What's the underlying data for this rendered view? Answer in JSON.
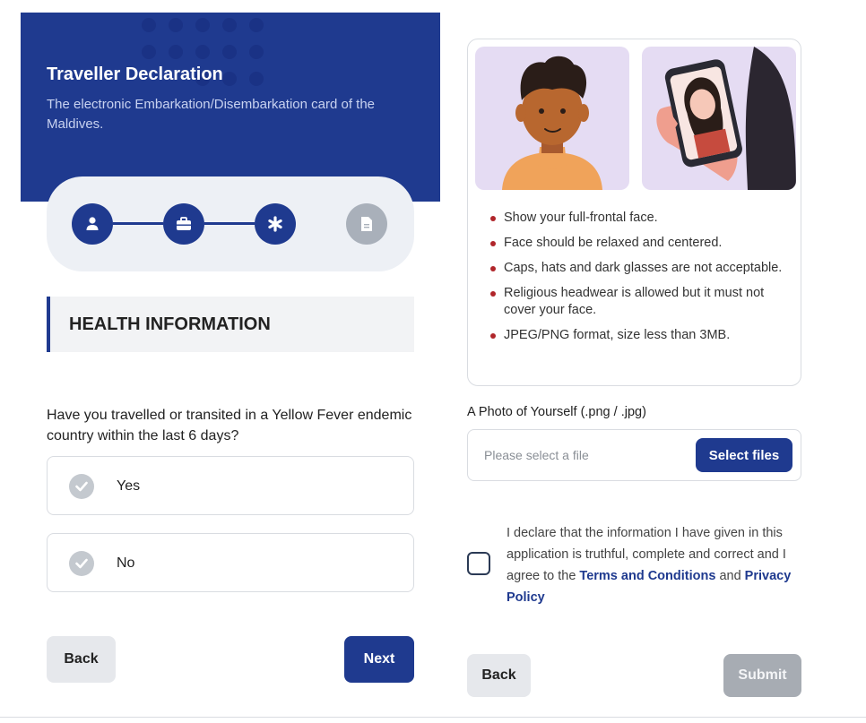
{
  "header": {
    "title": "Traveller Declaration",
    "subtitle": "The electronic Embarkation/Disembarkation card of the Maldives."
  },
  "stepper": {
    "steps": [
      {
        "icon": "user-icon",
        "state": "complete"
      },
      {
        "icon": "briefcase-icon",
        "state": "complete"
      },
      {
        "icon": "asterisk-icon",
        "state": "current"
      },
      {
        "icon": "document-icon",
        "state": "inactive"
      }
    ]
  },
  "section": {
    "title": "HEALTH INFORMATION"
  },
  "question": {
    "text": "Have you travelled or transited in a Yellow Fever endemic country within the last 6 days?",
    "options": [
      "Yes",
      "No"
    ]
  },
  "left_buttons": {
    "back": "Back",
    "next": "Next"
  },
  "photo_rules": [
    "Show your full-frontal face.",
    "Face should be relaxed and centered.",
    "Caps, hats and dark glasses are not acceptable.",
    "Religious headwear is allowed but it must not cover your face.",
    "JPEG/PNG format, size less than 3MB."
  ],
  "photo_upload": {
    "label": "A Photo of Yourself (.png / .jpg)",
    "placeholder": "Please select a file",
    "button": "Select files"
  },
  "declaration": {
    "text_start": "I declare that the information I have given in this application is truthful, complete and correct and I agree to the ",
    "terms_link": "Terms and Conditions",
    "and": " and ",
    "privacy_link": "Privacy Policy"
  },
  "right_buttons": {
    "back": "Back",
    "submit": "Submit"
  },
  "colors": {
    "primary": "#1f3a8f",
    "inactive": "#a9b0ba",
    "bullet": "#b0252a"
  }
}
